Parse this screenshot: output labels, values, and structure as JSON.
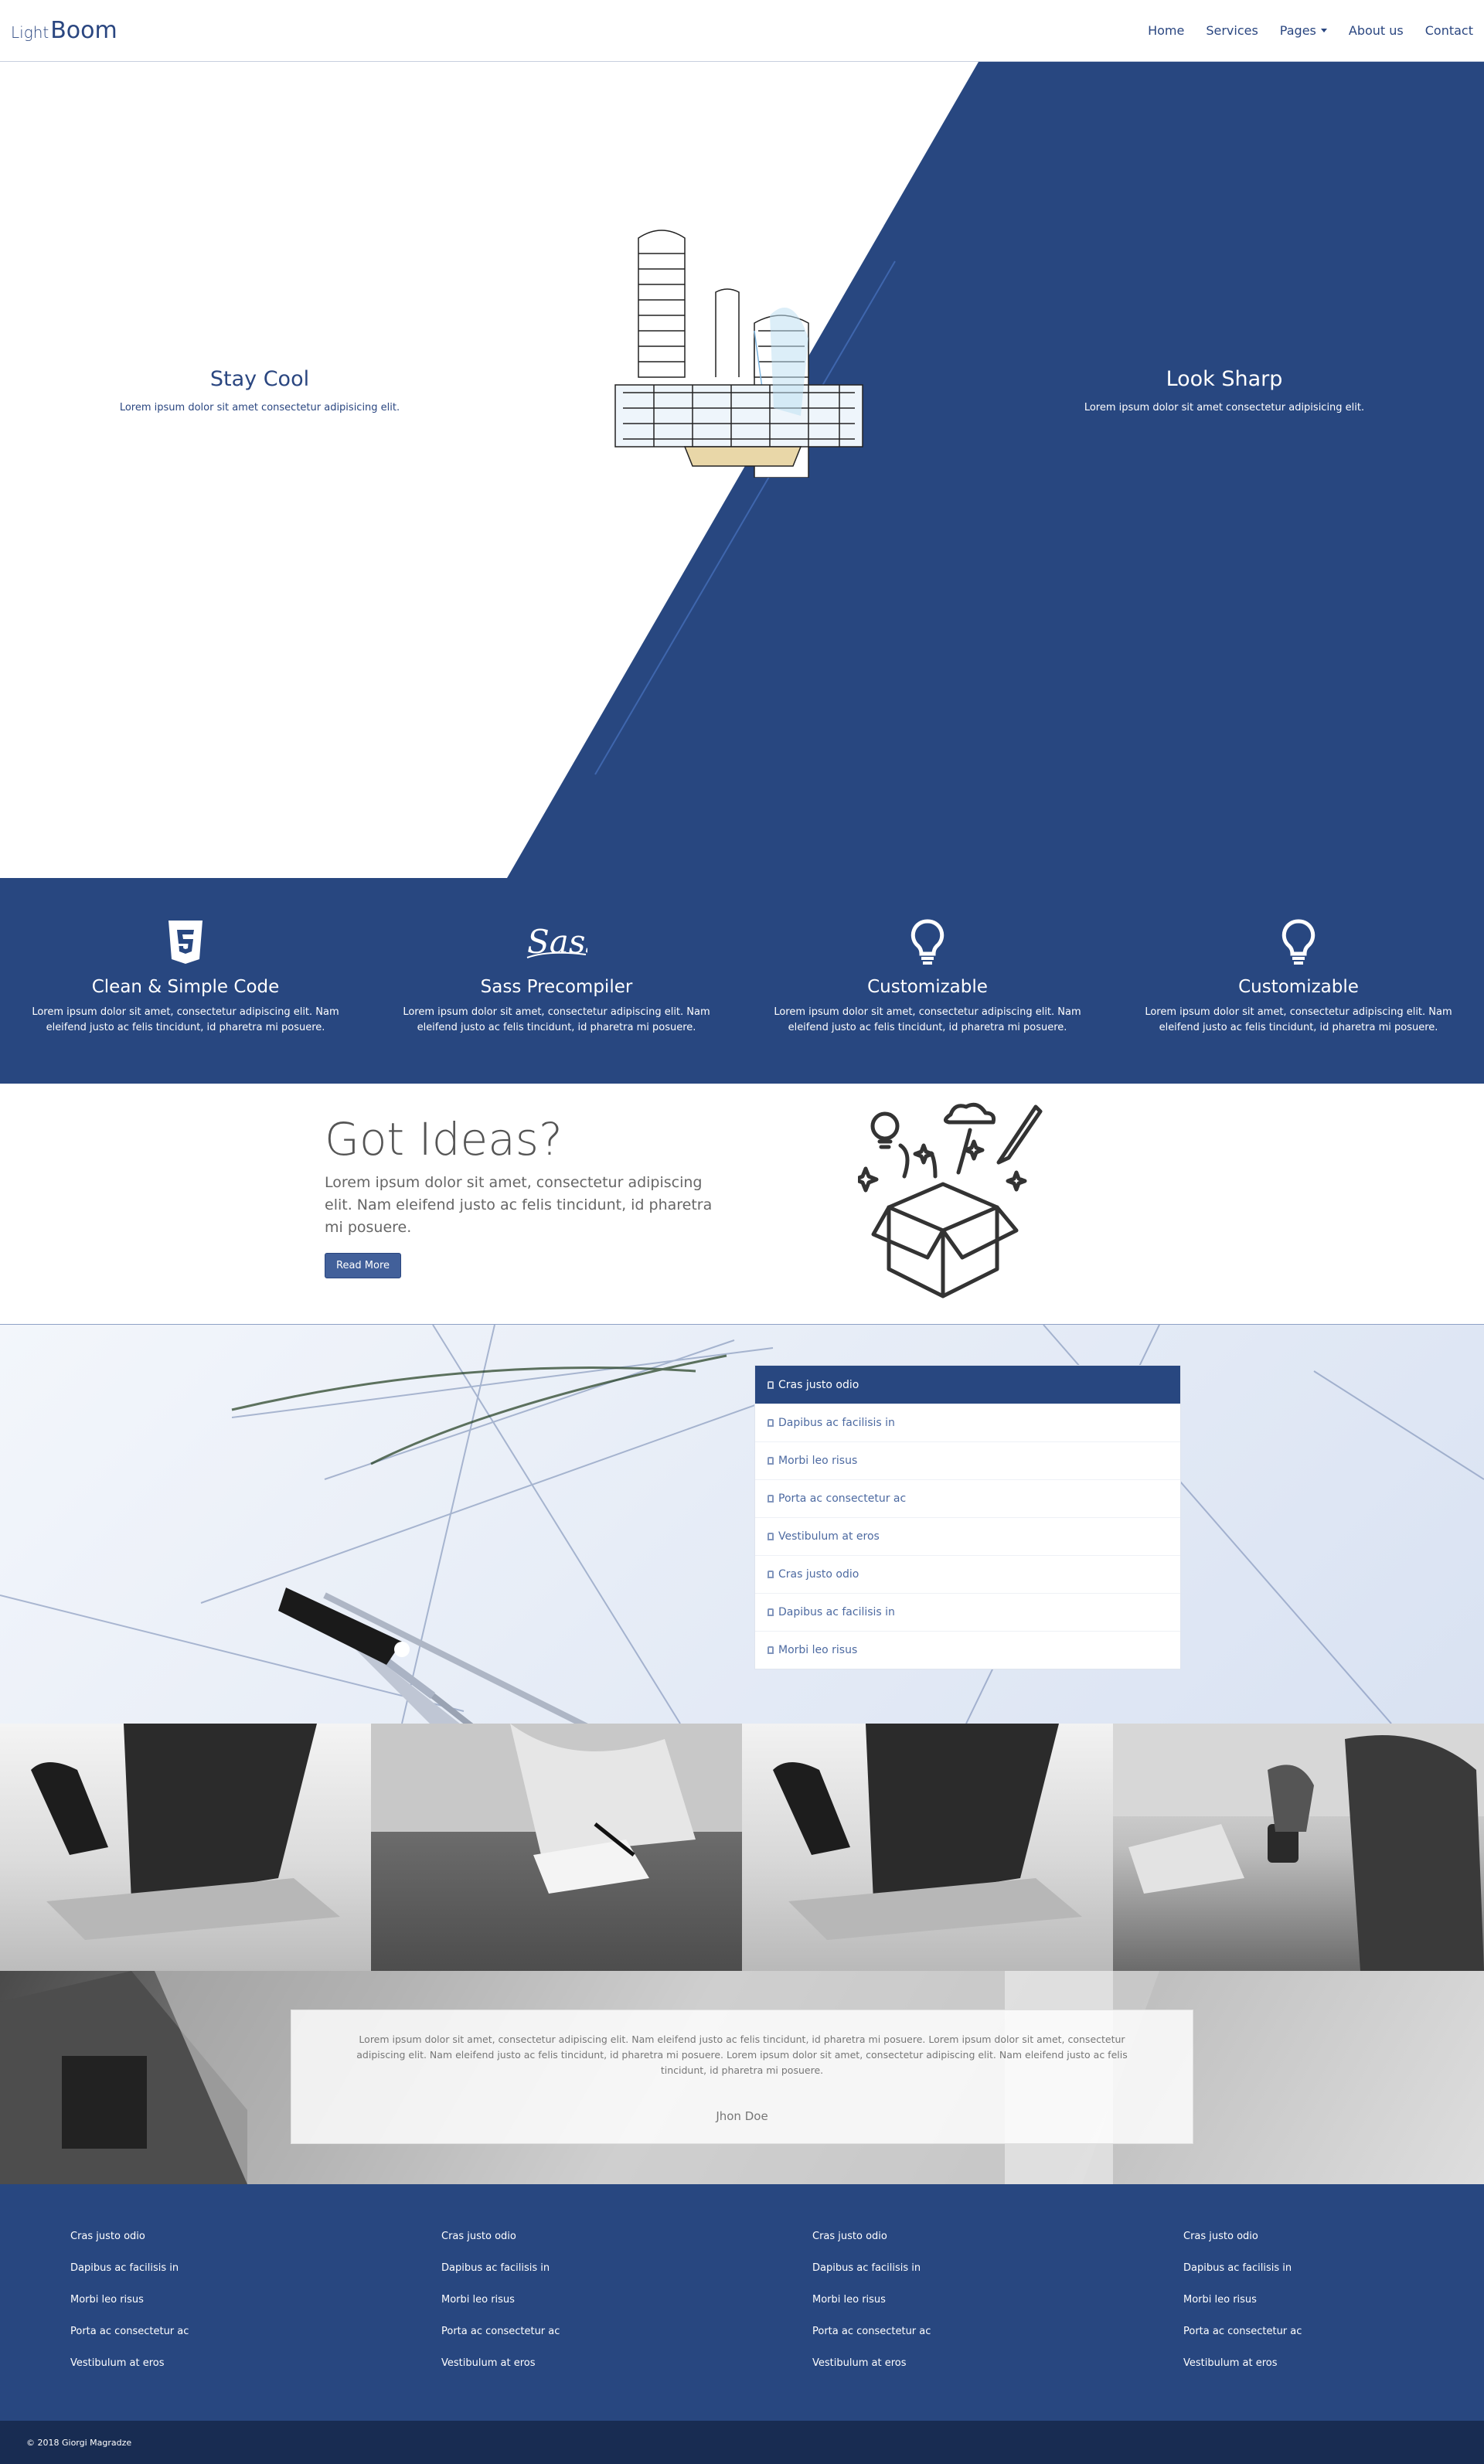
{
  "brand": {
    "light": "Light",
    "boom": "Boom"
  },
  "nav": {
    "items": [
      "Home",
      "Services",
      "Pages",
      "About us",
      "Contact"
    ]
  },
  "hero": {
    "left": {
      "title": "Stay Cool",
      "text": "Lorem ipsum dolor sit amet consectetur adipisicing elit."
    },
    "right": {
      "title": "Look Sharp",
      "text": "Lorem ipsum dolor sit amet consectetur adipisicing elit."
    }
  },
  "features": [
    {
      "icon": "html5-icon",
      "title": "Clean & Simple Code",
      "text": "Lorem ipsum dolor sit amet, consectetur adipiscing elit. Nam eleifend justo ac felis tincidunt, id pharetra mi posuere."
    },
    {
      "icon": "sass-icon",
      "title": "Sass Precompiler",
      "text": "Lorem ipsum dolor sit amet, consectetur adipiscing elit. Nam eleifend justo ac felis tincidunt, id pharetra mi posuere."
    },
    {
      "icon": "lightbulb-icon",
      "title": "Customizable",
      "text": "Lorem ipsum dolor sit amet, consectetur adipiscing elit. Nam eleifend justo ac felis tincidunt, id pharetra mi posuere."
    },
    {
      "icon": "lightbulb-icon",
      "title": "Customizable",
      "text": "Lorem ipsum dolor sit amet, consectetur adipiscing elit. Nam eleifend justo ac felis tincidunt, id pharetra mi posuere."
    }
  ],
  "ideas": {
    "title": "Got Ideas?",
    "text": "Lorem ipsum dolor sit amet, consectetur adipiscing elit. Nam eleifend justo ac felis tincidunt, id pharetra mi posuere.",
    "button": "Read More"
  },
  "list": {
    "items": [
      "Cras justo odio",
      "Dapibus ac facilisis in",
      "Morbi leo risus",
      "Porta ac consectetur ac",
      "Vestibulum at eros",
      "Cras justo odio",
      "Dapibus ac facilisis in",
      "Morbi leo risus"
    ],
    "active_index": 0
  },
  "testimonial": {
    "text": "Lorem ipsum dolor sit amet, consectetur adipiscing elit. Nam eleifend justo ac felis tincidunt, id pharetra mi posuere. Lorem ipsum dolor sit amet, consectetur adipiscing elit. Nam eleifend justo ac felis tincidunt, id pharetra mi posuere. Lorem ipsum dolor sit amet, consectetur adipiscing elit. Nam eleifend justo ac felis tincidunt, id pharetra mi posuere.",
    "author": "Jhon Doe"
  },
  "footer": {
    "columns": [
      [
        "Cras justo odio",
        "Dapibus ac facilisis in",
        "Morbi leo risus",
        "Porta ac consectetur ac",
        "Vestibulum at eros"
      ],
      [
        "Cras justo odio",
        "Dapibus ac facilisis in",
        "Morbi leo risus",
        "Porta ac consectetur ac",
        "Vestibulum at eros"
      ],
      [
        "Cras justo odio",
        "Dapibus ac facilisis in",
        "Morbi leo risus",
        "Porta ac consectetur ac",
        "Vestibulum at eros"
      ],
      [
        "Cras justo odio",
        "Dapibus ac facilisis in",
        "Morbi leo risus",
        "Porta ac consectetur ac",
        "Vestibulum at eros"
      ]
    ],
    "copyright": "© 2018 Giorgi Magradze"
  },
  "colors": {
    "primary": "#284780",
    "dark": "#182c52",
    "text": "#2a4680"
  }
}
